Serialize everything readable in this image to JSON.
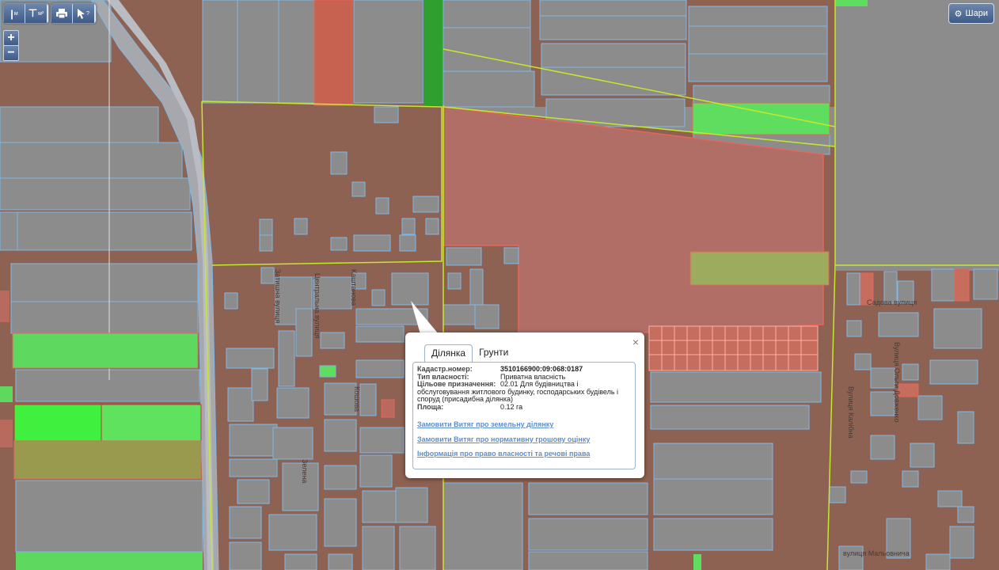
{
  "toolbar": {
    "buttons": [
      {
        "name": "measure-length-button",
        "icon": "ruler-icon",
        "sub": "м"
      },
      {
        "name": "measure-area-button",
        "icon": "area-icon",
        "sub": "м²"
      },
      {
        "name": "print-button",
        "icon": "printer-icon"
      },
      {
        "name": "identify-button",
        "icon": "cursor-question-icon",
        "sub": "?"
      }
    ]
  },
  "zoom": {
    "in": "+",
    "out": "−"
  },
  "layers_button": {
    "label": "Шари",
    "icon": "gear-icon"
  },
  "streets": [
    "Затишна вулиця",
    "Центральна вулиця",
    "Каштанова",
    "Кошова",
    "Зелена",
    "Садова вулиця",
    "Вулиця Ольги Довженко",
    "Вулиця Калібна",
    "вулиця Мальовнича"
  ],
  "popup": {
    "tabs": [
      "Ділянка",
      "Грунти"
    ],
    "active_tab": "Ділянка",
    "close": "×",
    "fields": {
      "cadastr_label": "Кадастр.номер:",
      "cadastr_value": "3510166900:09:068:0187",
      "ownership_label": "Тип власності:",
      "ownership_value": "Приватна власність",
      "purpose_label": "Цільове призначення:",
      "purpose_value": "02.01 Для будівництва і",
      "purpose_cont": "обслуговування житлового будинку, господарських будівель і споруд (присадибна ділянка)",
      "area_label": "Площа:",
      "area_value": "0.12 га"
    },
    "links": [
      "Замовити Витяг про земельну ділянку",
      "Замовити Витяг про нормативну грошову оцінку",
      "Інформація про право власності та речові права"
    ]
  },
  "colors": {
    "base": "#8c8c8c",
    "private": "#8e6252",
    "road": "#c58b78",
    "parcel_line": "#7fb8e6",
    "boundary": "#c6e82b",
    "red": "#e3675a",
    "green": "#5fdd5f",
    "bright_green": "#3ff03f"
  }
}
